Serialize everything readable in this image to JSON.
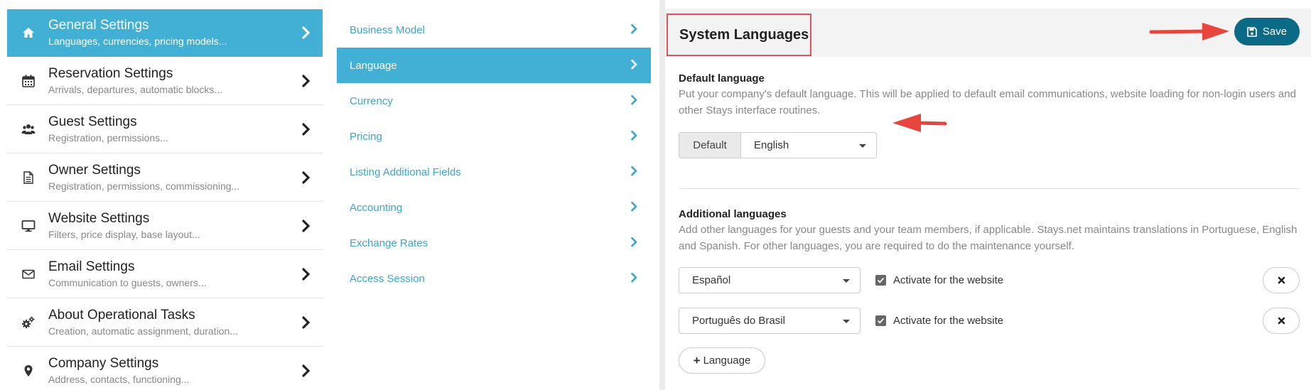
{
  "main_menu": [
    {
      "title": "General Settings",
      "subtitle": "Languages, currencies, pricing models...",
      "icon": "home-icon",
      "active": true
    },
    {
      "title": "Reservation Settings",
      "subtitle": "Arrivals, departures, automatic blocks...",
      "icon": "calendar-icon",
      "active": false
    },
    {
      "title": "Guest Settings",
      "subtitle": "Registration, permissions...",
      "icon": "users-icon",
      "active": false
    },
    {
      "title": "Owner Settings",
      "subtitle": "Registration, permissions, commissioning...",
      "icon": "document-icon",
      "active": false
    },
    {
      "title": "Website Settings",
      "subtitle": "Filters, price display, base layout...",
      "icon": "monitor-icon",
      "active": false
    },
    {
      "title": "Email Settings",
      "subtitle": "Communication to guests, owners...",
      "icon": "envelope-icon",
      "active": false
    },
    {
      "title": "About Operational Tasks",
      "subtitle": "Creation, automatic assignment, duration...",
      "icon": "gears-icon",
      "active": false
    },
    {
      "title": "Company Settings",
      "subtitle": "Address, contacts, functioning...",
      "icon": "map-pin-icon",
      "active": false
    }
  ],
  "sub_menu": [
    {
      "label": "Business Model",
      "active": false
    },
    {
      "label": "Language",
      "active": true
    },
    {
      "label": "Currency",
      "active": false
    },
    {
      "label": "Pricing",
      "active": false
    },
    {
      "label": "Listing Additional Fields",
      "active": false
    },
    {
      "label": "Accounting",
      "active": false
    },
    {
      "label": "Exchange Rates",
      "active": false
    },
    {
      "label": "Access Session",
      "active": false
    }
  ],
  "panel": {
    "title": "System Languages",
    "save_label": "Save",
    "default_section": {
      "heading": "Default language",
      "help": "Put your company's default language. This will be applied to default email communications, website loading for non-login users and other Stays interface routines.",
      "addon_label": "Default",
      "selected": "English"
    },
    "additional_section": {
      "heading": "Additional languages",
      "help": "Add other languages for your guests and your team members, if applicable. Stays.net maintains translations in Portuguese, English and Spanish. For other languages, you are required to do the maintenance yourself.",
      "rows": [
        {
          "language": "Español",
          "checkbox_label": "Activate for the website",
          "checked": true
        },
        {
          "language": "Português do Brasil",
          "checkbox_label": "Activate for the website",
          "checked": true
        }
      ],
      "add_label": "Language"
    }
  },
  "colors": {
    "accent": "#42b0d5",
    "link": "#3aa5cf",
    "save_button": "#0b6a86",
    "highlight_border": "#e0535a",
    "annotation_arrow": "#e8453c"
  }
}
